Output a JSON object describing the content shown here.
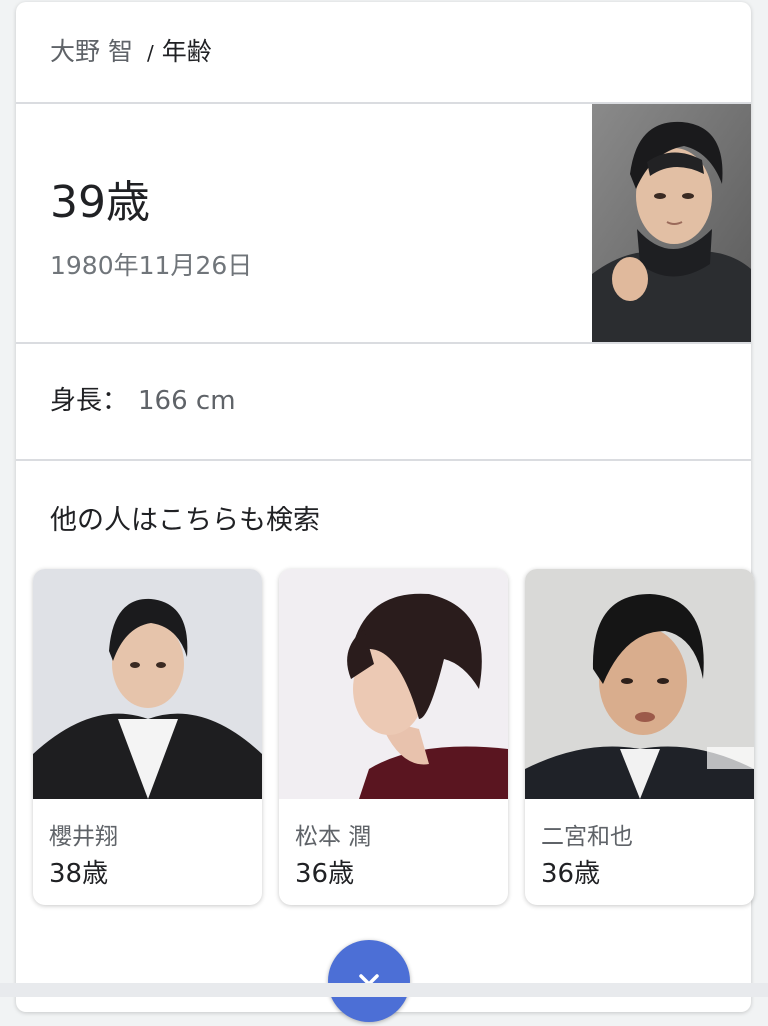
{
  "breadcrumb": {
    "entity": "大野 智",
    "separator": "/",
    "attribute": "年齢"
  },
  "answer": {
    "age": "39歳",
    "birthdate": "1980年11月26日"
  },
  "facts": {
    "height_label": "身長：",
    "height_value": "166 cm"
  },
  "people_also_search": {
    "title": "他の人はこちらも検索",
    "people": [
      {
        "name": "櫻井翔",
        "age": "38歳"
      },
      {
        "name": "松本 潤",
        "age": "36歳"
      },
      {
        "name": "二宮和也",
        "age": "36歳"
      }
    ]
  },
  "colors": {
    "accent": "#4c6fd6",
    "muted_text": "#5f6368",
    "divider": "#dadce0"
  },
  "icons": {
    "expand": "chevron-down-icon"
  }
}
